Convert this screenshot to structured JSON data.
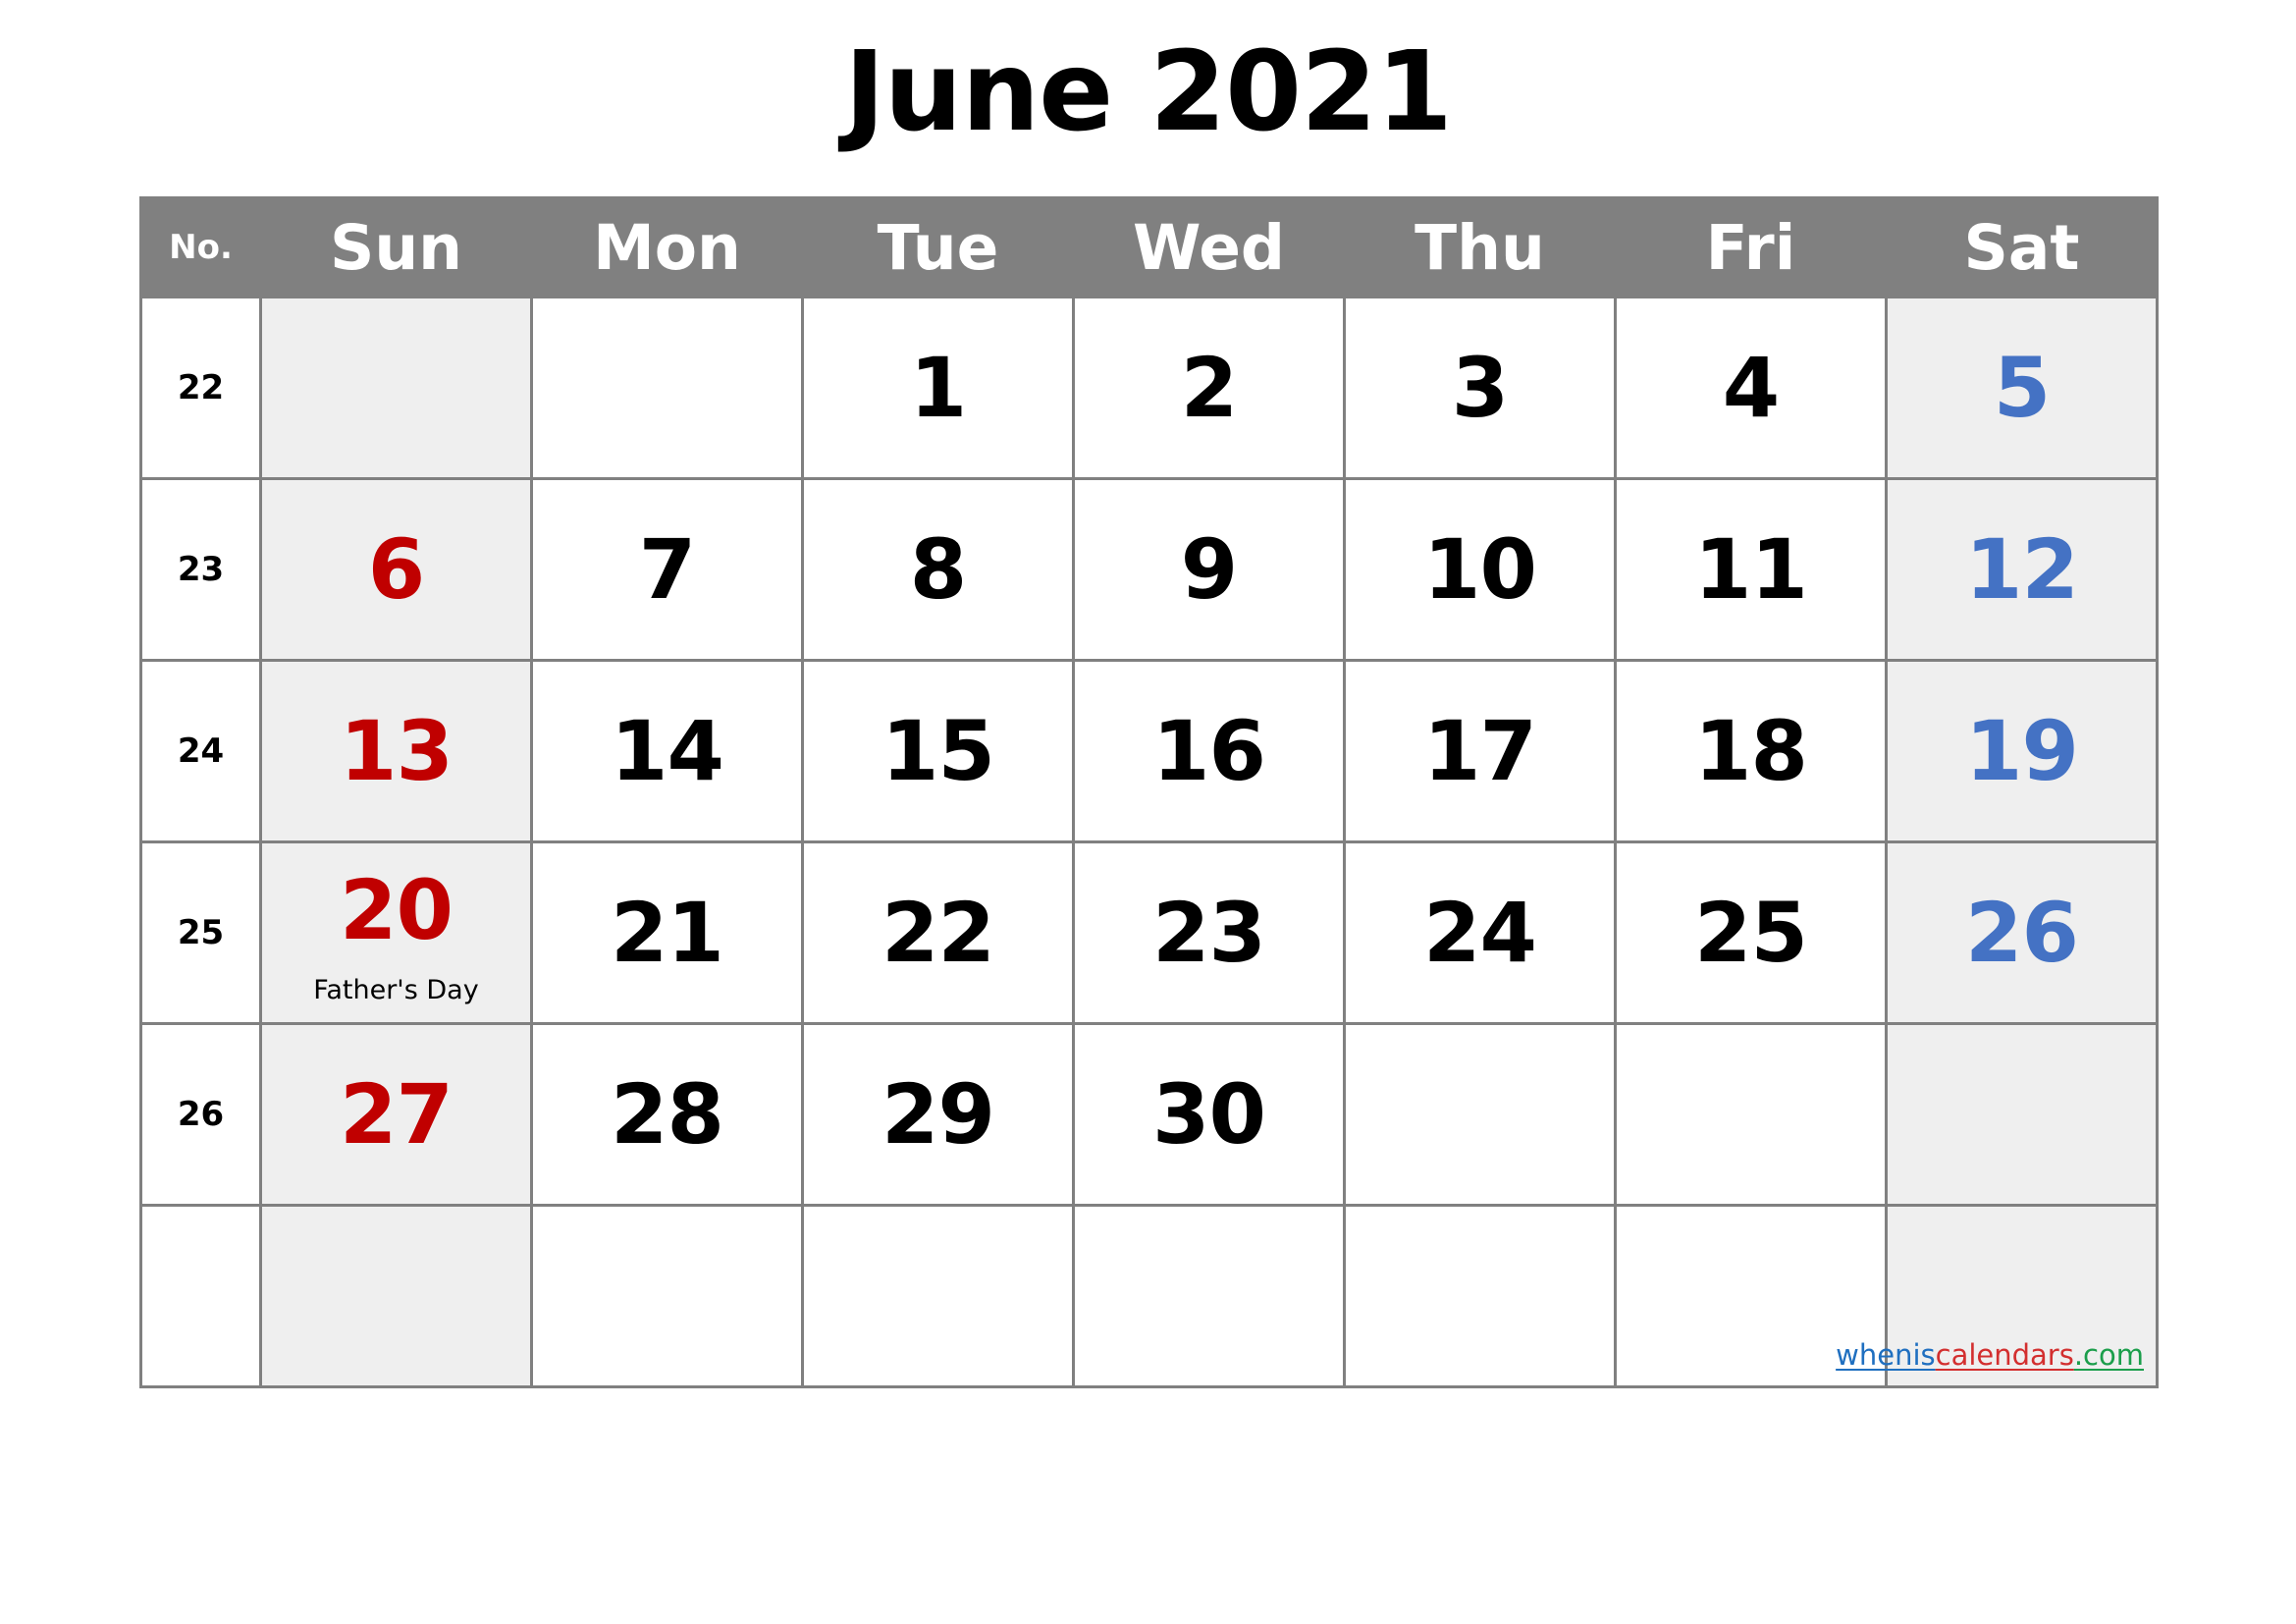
{
  "title": "June 2021",
  "header": {
    "week_number_label": "No.",
    "days": [
      "Sun",
      "Mon",
      "Tue",
      "Wed",
      "Thu",
      "Fri",
      "Sat"
    ]
  },
  "colors": {
    "header_bg": "#808080",
    "header_text": "#ffffff",
    "border": "#808080",
    "weekend_cell_bg": "#efefef",
    "sunday_text": "#C00000",
    "saturday_text": "#4472C4",
    "weekday_text": "#000000",
    "watermark_blue": "#1F6FC0",
    "watermark_red": "#D32F2F",
    "watermark_green": "#1B9E4B"
  },
  "watermark": {
    "part1": "whenis",
    "part2": "calendars",
    "part3": ".com"
  },
  "weeks": [
    {
      "number": "22",
      "days": [
        {
          "num": "",
          "event": ""
        },
        {
          "num": "",
          "event": ""
        },
        {
          "num": "1",
          "event": ""
        },
        {
          "num": "2",
          "event": ""
        },
        {
          "num": "3",
          "event": ""
        },
        {
          "num": "4",
          "event": ""
        },
        {
          "num": "5",
          "event": ""
        }
      ]
    },
    {
      "number": "23",
      "days": [
        {
          "num": "6",
          "event": ""
        },
        {
          "num": "7",
          "event": ""
        },
        {
          "num": "8",
          "event": ""
        },
        {
          "num": "9",
          "event": ""
        },
        {
          "num": "10",
          "event": ""
        },
        {
          "num": "11",
          "event": ""
        },
        {
          "num": "12",
          "event": ""
        }
      ]
    },
    {
      "number": "24",
      "days": [
        {
          "num": "13",
          "event": ""
        },
        {
          "num": "14",
          "event": ""
        },
        {
          "num": "15",
          "event": ""
        },
        {
          "num": "16",
          "event": ""
        },
        {
          "num": "17",
          "event": ""
        },
        {
          "num": "18",
          "event": ""
        },
        {
          "num": "19",
          "event": ""
        }
      ]
    },
    {
      "number": "25",
      "days": [
        {
          "num": "20",
          "event": "Father's Day"
        },
        {
          "num": "21",
          "event": ""
        },
        {
          "num": "22",
          "event": ""
        },
        {
          "num": "23",
          "event": ""
        },
        {
          "num": "24",
          "event": ""
        },
        {
          "num": "25",
          "event": ""
        },
        {
          "num": "26",
          "event": ""
        }
      ]
    },
    {
      "number": "26",
      "days": [
        {
          "num": "27",
          "event": ""
        },
        {
          "num": "28",
          "event": ""
        },
        {
          "num": "29",
          "event": ""
        },
        {
          "num": "30",
          "event": ""
        },
        {
          "num": "",
          "event": ""
        },
        {
          "num": "",
          "event": ""
        },
        {
          "num": "",
          "event": ""
        }
      ]
    },
    {
      "number": "",
      "days": [
        {
          "num": "",
          "event": ""
        },
        {
          "num": "",
          "event": ""
        },
        {
          "num": "",
          "event": ""
        },
        {
          "num": "",
          "event": ""
        },
        {
          "num": "",
          "event": ""
        },
        {
          "num": "",
          "event": ""
        },
        {
          "num": "",
          "event": ""
        }
      ]
    }
  ]
}
